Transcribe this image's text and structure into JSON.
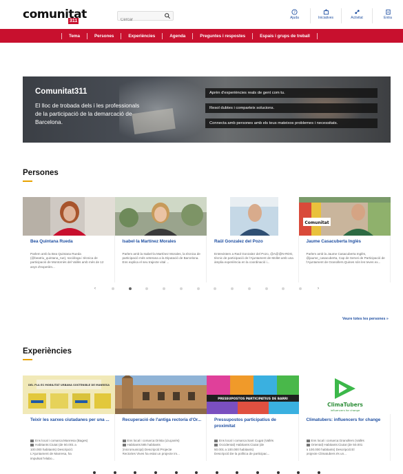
{
  "header": {
    "logo": "comunitat",
    "logo_badge": "311",
    "search_placeholder": "Cercar",
    "tools": [
      {
        "label": "Ajuda",
        "icon": "help-icon"
      },
      {
        "label": "Iniciatives",
        "icon": "initiatives-icon"
      },
      {
        "label": "Activitat",
        "icon": "activity-icon"
      },
      {
        "label": "Entra",
        "icon": "login-icon"
      }
    ]
  },
  "nav": [
    "Tema",
    "Persones",
    "Experiències",
    "Agenda",
    "Preguntes i respostes",
    "Espais i grups de treball"
  ],
  "hero": {
    "title": "Comunitat311",
    "text": "El lloc de trobada dels i les professionals de la participació de la demarcació de Barcelona.",
    "lines": [
      "Aprèn d'experiències reals de gent com tu.",
      "Resol dubtes i comparteix solucions.",
      "Connecta amb persones amb els teus mateixos problemes i necessitats."
    ]
  },
  "persones": {
    "title": "Persones",
    "see_all": "Veure totes les persones »",
    "cards": [
      {
        "name": "Bea Quintana Rueda",
        "desc": "Parlem amb la Bea Quintana Rueda (@beatriu_quintana_rue), sociòloga i tècnica de participació de Montornès del Vallès amb més de 12 anys d'experièn..."
      },
      {
        "name": "Isabel·la Martínez Morales",
        "desc": "Parlem amb la Isabel·la Martínez Morales, la tècnica de participació més veterana a la Diputació de Barcelona. Ens explica el seu trajecte vital ..."
      },
      {
        "name": "Raül Gonzalez del Pozo",
        "desc": "Entrevistem a Raül Gonzalez del Pozo, @A@@N-RDG, tècnic de participació de l'Ajuntament de Mollet amb una àmplia experiència en la coordinació i..."
      },
      {
        "name": "Jaume Casacuberta Inglès",
        "desc": "Parlem amb la Jaume Casacuberta Inglès, @jaume_casacuberta, Cap de Servei de Participació de l'Ajuntament de Granollers.Quines són les teves ex..."
      }
    ],
    "photo_caption": "Comunitat"
  },
  "experiencies": {
    "title": "Experiències",
    "cards": [
      {
        "name": "Teixir les xarxes ciutadanes per una ...",
        "lines": [
          "Ens local i comarca:Manresa (Bages)",
          "Habitants:Ciutat (de 50.001 a",
          "100.000 habitants) Descripció:",
          "L'Ajuntament de Manresa, ha",
          "impulsat l'elabo..."
        ]
      },
      {
        "name": "Recuperació de l'antiga rectoria d'Or...",
        "lines": [
          "Ens local i comarca:Orista (Lluçanès)",
          "Habitants:585 habitants",
          "(micromunicipi) Descripció:Projecte",
          "Rectories Vives ha estat un projecte im..."
        ]
      },
      {
        "name": "Pressupostos participatius de proximitat",
        "lines": [
          "Ens local i comarca:Sant Cugat (Vallès",
          "Occidental) Habitants:Ciutat (de",
          "50.001 a 100.000 habitants)",
          "Descripció:De la política de participac..."
        ]
      },
      {
        "name": "Climatubers: influencers for change",
        "lines": [
          "Ens local i comarca:Granollers (Vallès",
          "Oriental) Habitants:Ciutat (de 50.001",
          "a 100.000 habitants) Descripció:El",
          "projecte Climatubers és un..."
        ]
      }
    ],
    "thumb_texts": {
      "poster": "DEL PLA ES MOBILITAT URBANA SOSTENIBLE DE MANRESA",
      "banner": "PRESSUPOSTOS PARTICIPATIUS DE BARRI",
      "brand": "ClimaTubers",
      "brand_sub": "influencers for change"
    }
  },
  "pager": {
    "prev": "‹",
    "next": "›",
    "dots": 12,
    "active": 1
  }
}
